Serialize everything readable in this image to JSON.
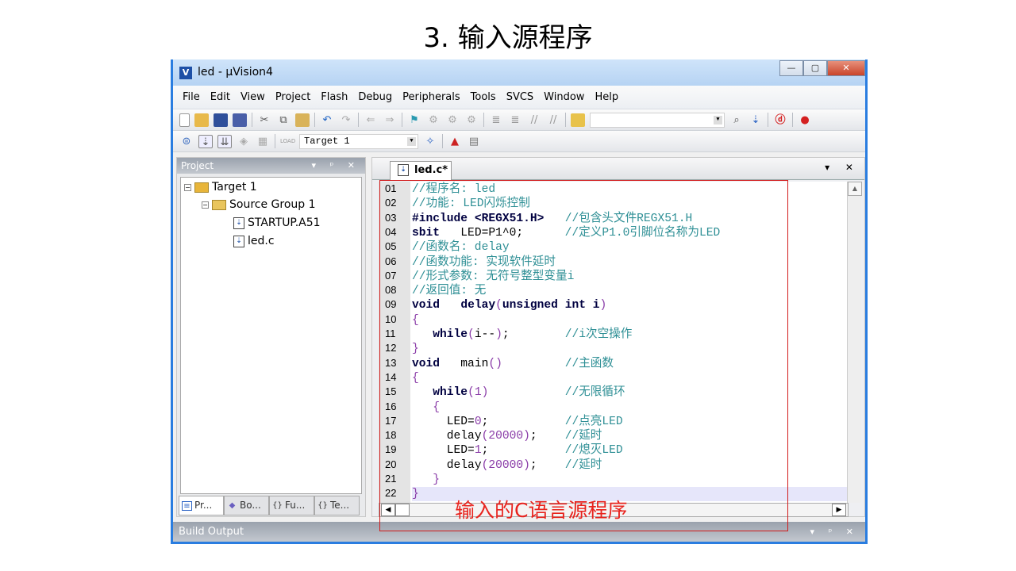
{
  "slide_title": "3. 输入源程序",
  "window": {
    "title": "led  - µVision4",
    "app_icon": "uv4-icon",
    "min": "—",
    "max": "▢",
    "close": "✕"
  },
  "menu": [
    "File",
    "Edit",
    "View",
    "Project",
    "Flash",
    "Debug",
    "Peripherals",
    "Tools",
    "SVCS",
    "Window",
    "Help"
  ],
  "toolbar": {
    "target_select": "Target 1",
    "find_combo": ""
  },
  "project_panel": {
    "title": "Project",
    "controls": "▾ ᵖ ✕",
    "tree": [
      {
        "label": "Target 1",
        "level": 0
      },
      {
        "label": "Source Group 1",
        "level": 1
      },
      {
        "label": "STARTUP.A51",
        "level": 2
      },
      {
        "label": "led.c",
        "level": 2
      }
    ],
    "tabs": [
      "Pr...",
      "Bo...",
      "Fu...",
      "Te..."
    ]
  },
  "editor": {
    "tab_label": "led.c*",
    "controls": "▾ ✕",
    "lines": [
      [
        [
          "c",
          "//程序名: led"
        ]
      ],
      [
        [
          "c",
          "//功能: LED闪烁控制"
        ]
      ],
      [
        [
          "k",
          "#include <REGX51.H>"
        ],
        [
          "t",
          "   "
        ],
        [
          "c",
          "//包含头文件REGX51.H"
        ]
      ],
      [
        [
          "k",
          "sbit"
        ],
        [
          "t",
          "   LED=P1^0;      "
        ],
        [
          "c",
          "//定义P1.0引脚位名称为LED"
        ]
      ],
      [
        [
          "c",
          "//函数名: delay"
        ]
      ],
      [
        [
          "c",
          "//函数功能: 实现软件延时"
        ]
      ],
      [
        [
          "c",
          "//形式参数: 无符号整型变量i"
        ]
      ],
      [
        [
          "c",
          "//返回值: 无"
        ]
      ],
      [
        [
          "k",
          "void"
        ],
        [
          "t",
          "   "
        ],
        [
          "k",
          "delay"
        ],
        [
          "n",
          "("
        ],
        [
          "k",
          "unsigned int i"
        ],
        [
          "n",
          ")"
        ]
      ],
      [
        [
          "n",
          "{"
        ]
      ],
      [
        [
          "t",
          "   "
        ],
        [
          "k",
          "while"
        ],
        [
          "n",
          "("
        ],
        [
          "t",
          "i--"
        ],
        [
          "n",
          ")"
        ],
        [
          "t",
          ";        "
        ],
        [
          "c",
          "//i次空操作"
        ]
      ],
      [
        [
          "n",
          "}"
        ]
      ],
      [
        [
          "k",
          "void"
        ],
        [
          "t",
          "   main"
        ],
        [
          "n",
          "()"
        ],
        [
          "t",
          "         "
        ],
        [
          "c",
          "//主函数"
        ]
      ],
      [
        [
          "n",
          "{"
        ]
      ],
      [
        [
          "t",
          "   "
        ],
        [
          "k",
          "while"
        ],
        [
          "n",
          "(1)"
        ],
        [
          "t",
          "           "
        ],
        [
          "c",
          "//无限循环"
        ]
      ],
      [
        [
          "t",
          "   "
        ],
        [
          "n",
          "{"
        ]
      ],
      [
        [
          "t",
          "     LED="
        ],
        [
          "n",
          "0"
        ],
        [
          "t",
          ";           "
        ],
        [
          "c",
          "//点亮LED"
        ]
      ],
      [
        [
          "t",
          "     delay"
        ],
        [
          "n",
          "(20000)"
        ],
        [
          "t",
          ";    "
        ],
        [
          "c",
          "//延时"
        ]
      ],
      [
        [
          "t",
          "     LED="
        ],
        [
          "n",
          "1"
        ],
        [
          "t",
          ";           "
        ],
        [
          "c",
          "//熄灭LED"
        ]
      ],
      [
        [
          "t",
          "     delay"
        ],
        [
          "n",
          "(20000)"
        ],
        [
          "t",
          ";    "
        ],
        [
          "c",
          "//延时"
        ]
      ],
      [
        [
          "t",
          "   "
        ],
        [
          "n",
          "}"
        ]
      ],
      [
        [
          "n",
          "}"
        ]
      ]
    ]
  },
  "build_output": {
    "title": "Build Output",
    "controls": "▾ ᵖ ✕"
  },
  "annotation": "输入的C语言源程序",
  "colors": {
    "keyword": "#000040",
    "comment": "#2e8f95",
    "number": "#8a3ca8",
    "annotation": "#e8231d"
  }
}
